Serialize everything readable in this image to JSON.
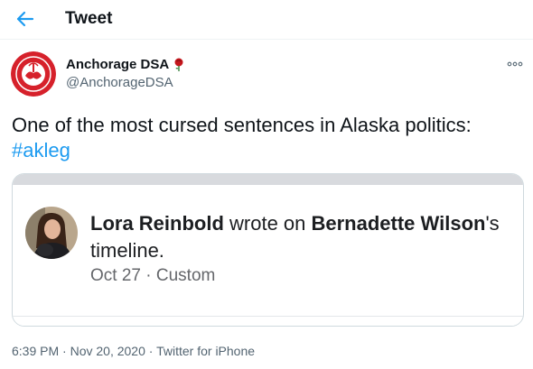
{
  "header": {
    "title": "Tweet",
    "back_icon": "arrow-left-icon",
    "accent": "#1d9bf0"
  },
  "author": {
    "name": "Anchorage DSA",
    "handle": "@AnchorageDSA",
    "badge_icon": "rose-icon",
    "avatar_color": "#d6212b"
  },
  "tweet": {
    "text": "One of the most cursed sentences in Alaska politics:",
    "hashtag": "#akleg"
  },
  "media": {
    "person_name": "Lora Reinbold",
    "action": " wrote on ",
    "target_name": "Bernadette Wilson",
    "suffix": "'s",
    "line2": "timeline.",
    "date": "Oct 27",
    "separator": " · ",
    "audience": "Custom"
  },
  "footer": {
    "time": "6:39 PM",
    "date": "Nov 20, 2020",
    "source": "Twitter for iPhone",
    "separator": " · "
  }
}
